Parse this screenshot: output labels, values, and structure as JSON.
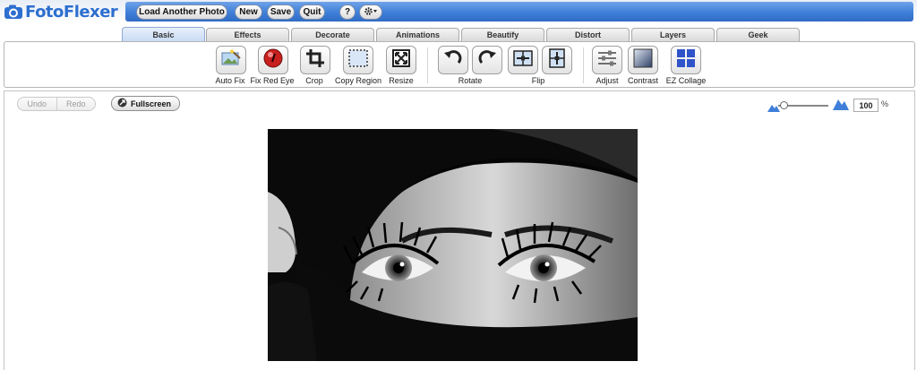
{
  "app": {
    "name": "FotoFlexer",
    "accent": "#3f7fd9"
  },
  "header": {
    "load_label": "Load Another Photo",
    "new_label": "New",
    "save_label": "Save",
    "quit_label": "Quit",
    "help_label": "?",
    "settings_icon": "gear-icon"
  },
  "tabs": [
    {
      "label": "Basic",
      "active": true
    },
    {
      "label": "Effects"
    },
    {
      "label": "Decorate"
    },
    {
      "label": "Animations"
    },
    {
      "label": "Beautify"
    },
    {
      "label": "Distort"
    },
    {
      "label": "Layers"
    },
    {
      "label": "Geek"
    }
  ],
  "tools": {
    "auto_fix": "Auto Fix",
    "fix_red_eye": "Fix Red Eye",
    "crop": "Crop",
    "copy_region": "Copy Region",
    "resize": "Resize",
    "rotate": "Rotate",
    "flip": "Flip",
    "adjust": "Adjust",
    "contrast": "Contrast",
    "ez_collage": "EZ Collage"
  },
  "canvas": {
    "undo_label": "Undo",
    "redo_label": "Redo",
    "fullscreen_label": "Fullscreen",
    "zoom_value": "100",
    "zoom_unit": "%"
  }
}
